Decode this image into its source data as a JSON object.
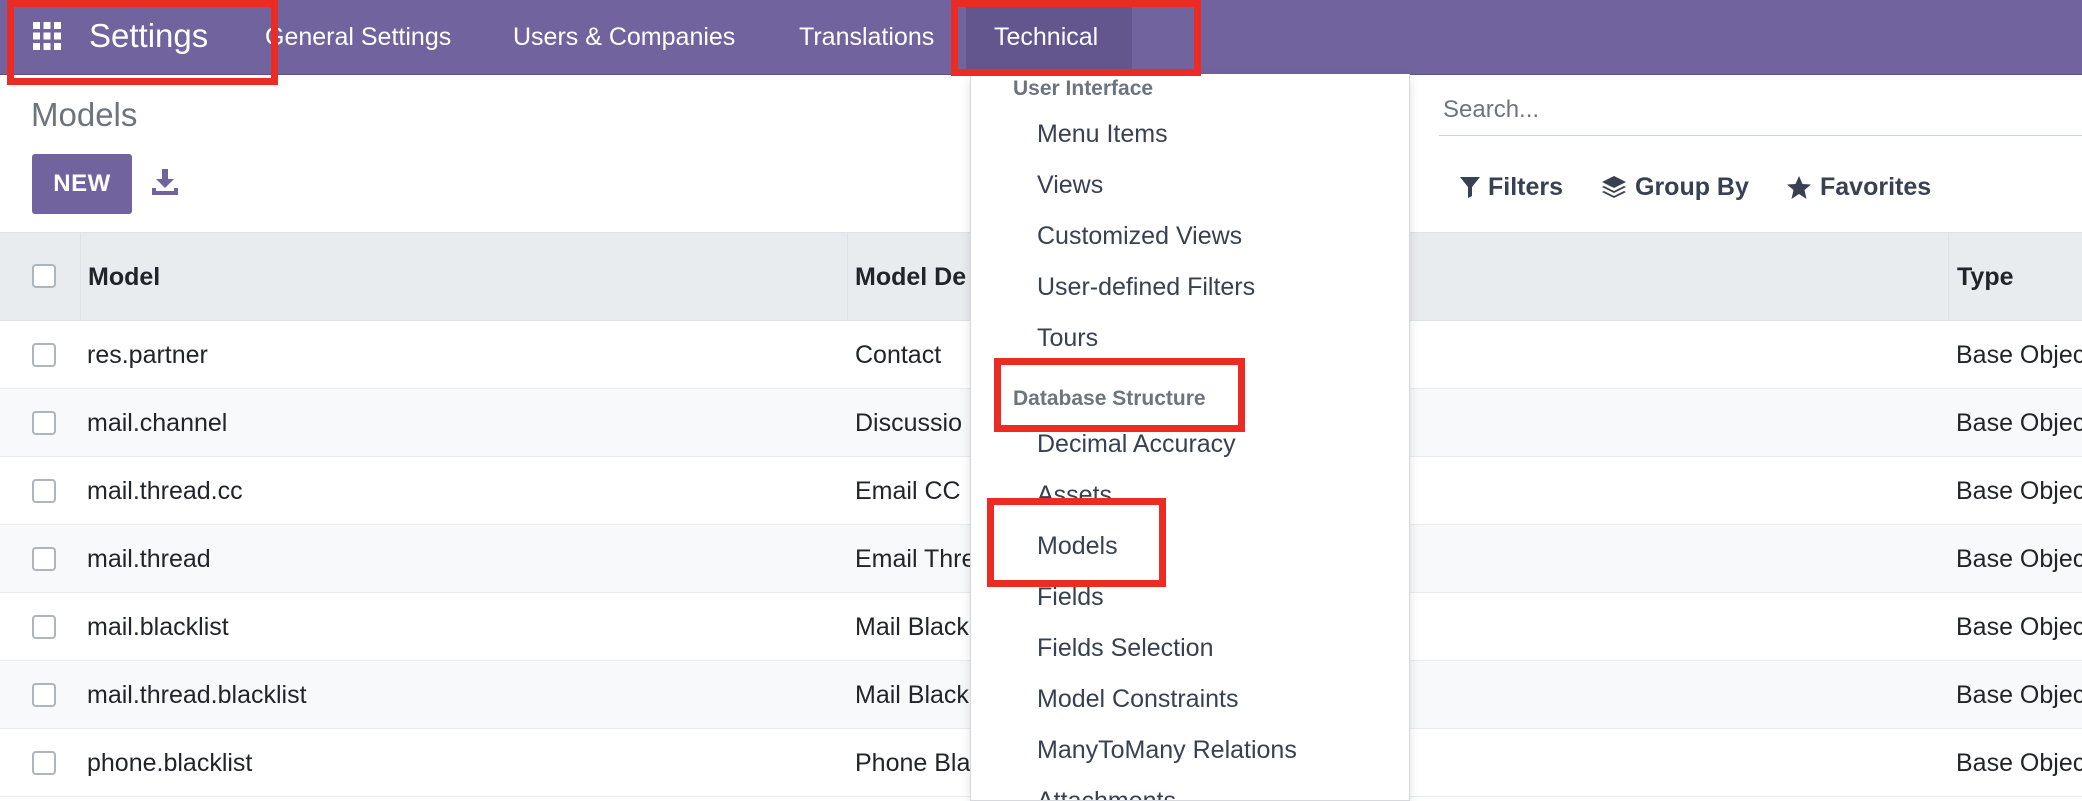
{
  "navbar": {
    "app_title": "Settings",
    "menu": [
      "General Settings",
      "Users & Companies",
      "Translations",
      "Technical"
    ],
    "accent_color": "#71639e"
  },
  "control_panel": {
    "title": "Models",
    "new_label": "NEW",
    "search_placeholder": "Search...",
    "filters_label": "Filters",
    "groupby_label": "Group By",
    "favorites_label": "Favorites"
  },
  "table": {
    "columns": [
      "Model",
      "Model De",
      "Type"
    ],
    "rows": [
      {
        "model": "res.partner",
        "description": "Contact",
        "type": "Base Objec"
      },
      {
        "model": "mail.channel",
        "description": "Discussio",
        "type": "Base Objec"
      },
      {
        "model": "mail.thread.cc",
        "description": "Email CC",
        "type": "Base Objec"
      },
      {
        "model": "mail.thread",
        "description": "Email Thre",
        "type": "Base Objec"
      },
      {
        "model": "mail.blacklist",
        "description": "Mail Black",
        "type": "Base Objec"
      },
      {
        "model": "mail.thread.blacklist",
        "description": "Mail Black",
        "type": "Base Objec"
      },
      {
        "model": "phone.blacklist",
        "description": "Phone Bla",
        "type": "Base Objec"
      }
    ]
  },
  "dropdown": {
    "section_user_interface": "User Interface",
    "user_interface_items": [
      "Menu Items",
      "Views",
      "Customized Views",
      "User-defined Filters",
      "Tours"
    ],
    "section_database_structure": "Database Structure",
    "database_structure_items": [
      "Decimal Accuracy",
      "Assets",
      "Models",
      "Fields",
      "Fields Selection",
      "Model Constraints",
      "ManyToMany Relations",
      "Attachments"
    ]
  },
  "icons": [
    "apps-grid-icon",
    "download-icon",
    "filter-icon",
    "layers-icon",
    "star-icon"
  ],
  "highlight_color": "#ea2c24"
}
